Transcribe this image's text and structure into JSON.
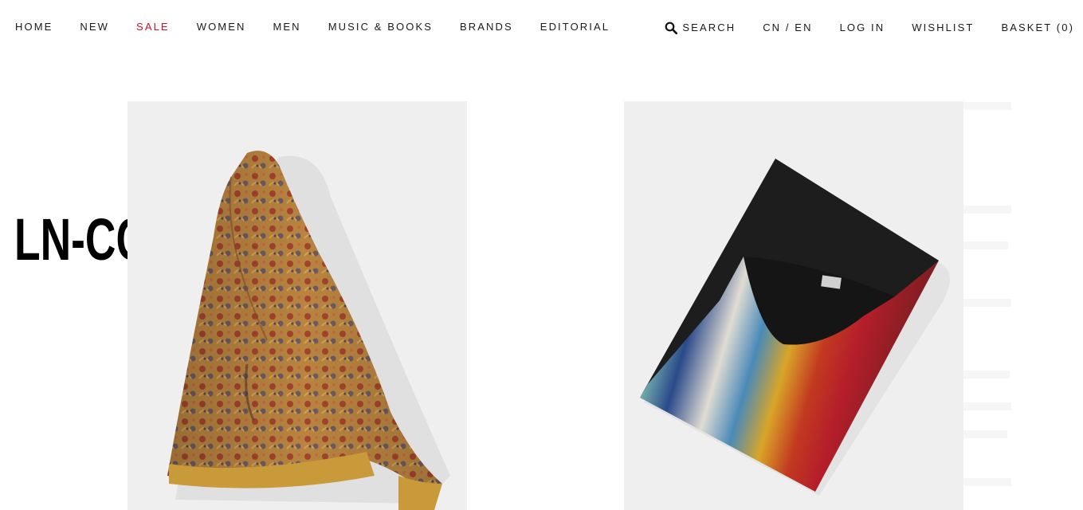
{
  "nav": {
    "left": [
      "HOME",
      "NEW",
      "SALE",
      "WOMEN",
      "MEN",
      "MUSIC & BOOKS",
      "BRANDS",
      "EDITORIAL"
    ],
    "search_label": "SEARCH",
    "language": "CN / EN",
    "login": "LOG IN",
    "wishlist": "WISHLIST",
    "basket": "BASKET (0)"
  },
  "logo": {
    "text": "LN-CC"
  },
  "colors": {
    "sale": "#c8102e",
    "text": "#1a1a1a",
    "product_bg": "#efefef"
  },
  "icons": {
    "search": "search-icon"
  },
  "products": [
    {
      "name": "paisley-bomber-jacket-image"
    },
    {
      "name": "striped-corduroy-top-image"
    }
  ]
}
